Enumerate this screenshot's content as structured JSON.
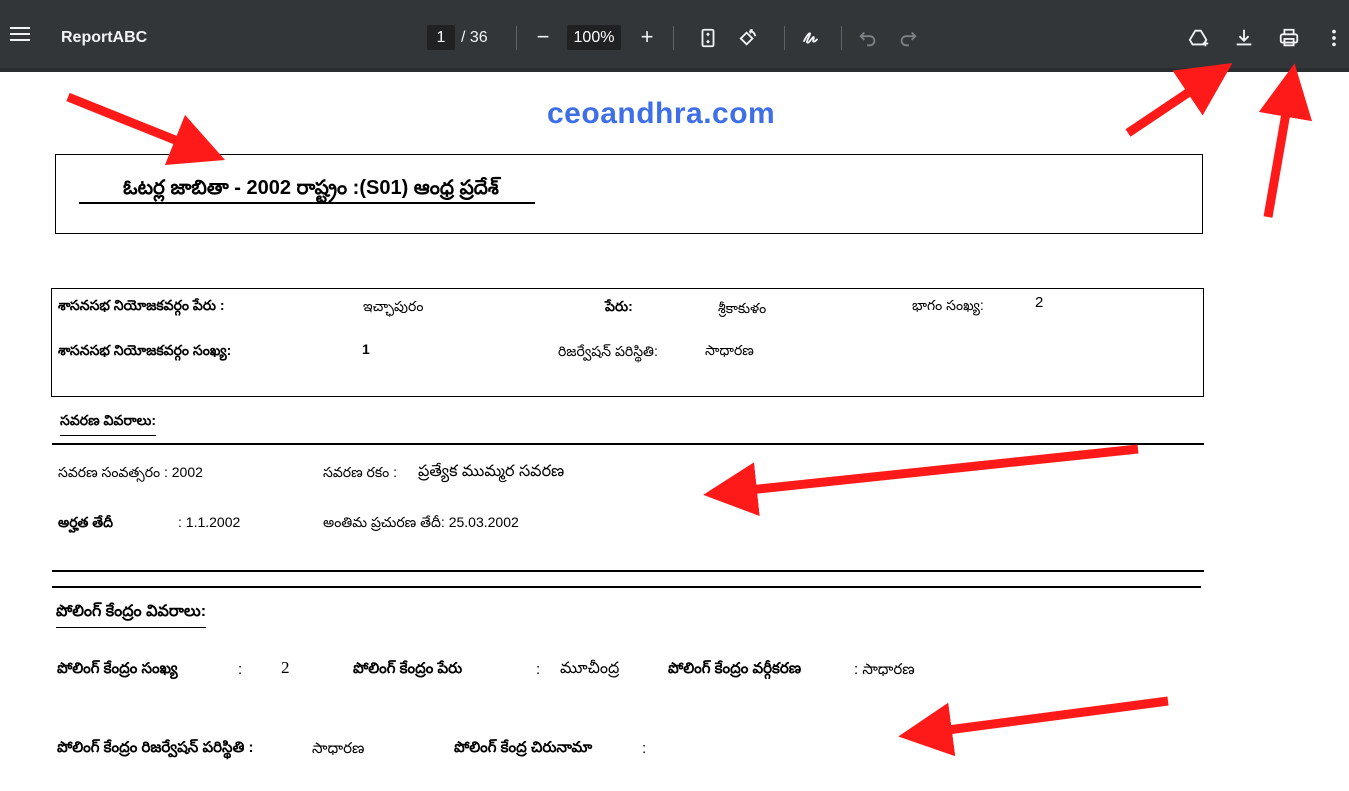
{
  "toolbar": {
    "menu_icon": "hamburger-menu-icon",
    "title": "ReportABC",
    "current_page": "1",
    "total_pages": "/ 36",
    "zoom": "100%",
    "zoom_out_symbol": "−",
    "zoom_in_symbol": "+"
  },
  "document": {
    "site": "ceoandhra.com",
    "title": "ఓటర్ల జాబితా - 2002 రాష్ట్రం :(S01) ఆంధ్ర ప్రదేశ్",
    "constituency": {
      "name_label": "శాసనసభ నియోజకవర్గం పేరు :",
      "name_value": "ఇచ్ఛాపురం",
      "district_label": "పేరు:",
      "district_value": "శ్రీకాకుళం",
      "part_label": "భాగం సంఖ్య:",
      "part_value": "2",
      "number_label": "శాసనసభ నియోజకవర్గం సంఖ్య:",
      "number_value": "1",
      "reservation_label": "రిజర్వేషన్ పరిస్థితి:",
      "reservation_value": "సాధారణ"
    },
    "revision": {
      "heading": "సవరణ వివరాలు:",
      "year_label": "సవరణ సంవత్సరం : 2002",
      "type_label": "సవరణ రకం :",
      "type_value": "ప్రత్యేక ముమ్మర సవరణ",
      "qualifying_label": "అర్హత తేదీ",
      "qualifying_value": ": 1.1.2002",
      "final_pub": "అంతిమ ప్రచురణ తేదీ: 25.03.2002"
    },
    "polling": {
      "heading": "పోలింగ్ కేంద్రం వివరాలు:",
      "number_label": "పోలింగ్ కేంద్రం సంఖ్య",
      "number_colon": ":",
      "number_value": "2",
      "name_label": "పోలింగ్ కేంద్రం పేరు",
      "name_colon": ":",
      "name_value": "మూచీంద్ర",
      "class_label": "పోలింగ్ కేంద్రం వర్గీకరణ",
      "class_value": ": సాధారణ",
      "reservation_label": "పోలింగ్ కేంద్రం రిజర్వేషన్ పరిస్థితి :",
      "reservation_value": "సాధారణ",
      "address_label": "పోలింగ్ కేంద్ర చిరునామా",
      "address_colon": ":"
    }
  },
  "colors": {
    "toolbar_bg": "#323639",
    "site_link": "#3f6fe8",
    "annotation_arrow": "#ff1a1a"
  }
}
